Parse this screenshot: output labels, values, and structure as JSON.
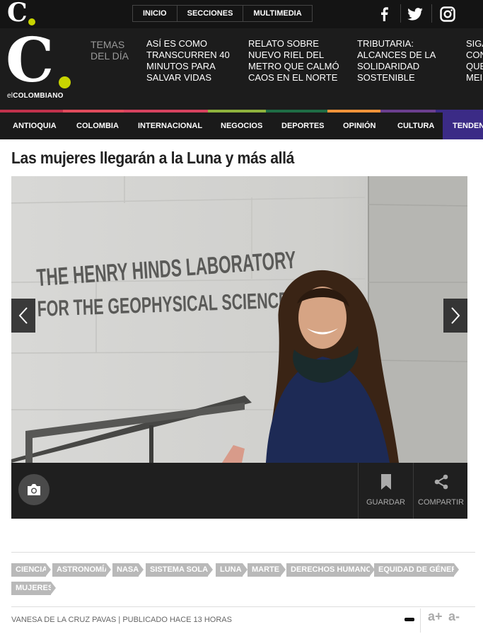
{
  "header": {
    "logo_letter": "C",
    "top_nav": [
      "INICIO",
      "SECCIONES",
      "MULTIMEDIA"
    ],
    "social": [
      "facebook-icon",
      "twitter-icon",
      "instagram-icon"
    ],
    "brand_prefix": "el",
    "brand_name": "COLOMBIANO",
    "temas_label": "TEMAS DEL DÍA",
    "topics": [
      "ASÍ ES COMO TRANSCURREN 40 MINUTOS PARA SALVAR VIDAS",
      "RELATO SOBRE NUEVO RIEL DEL METRO QUE CALMÓ CAOS EN EL NORTE",
      "TRIBUTARIA: ALCANCES DE LA SOLIDARIDAD SOSTENIBLE",
      "SIGA CON QUE MEI"
    ],
    "accent_color": "#c8d400"
  },
  "sections": {
    "items": [
      "ANTIOQUIA",
      "COLOMBIA",
      "INTERNACIONAL",
      "NEGOCIOS",
      "DEPORTES",
      "OPINIÓN",
      "CULTURA",
      "TENDEN"
    ],
    "bar_colors": [
      "#c0314b",
      "#e04b5c",
      "#d5435f",
      "#8fb23d",
      "#1f6d45",
      "#f0933a",
      "#6b3f8f",
      "#3b2b86"
    ]
  },
  "article": {
    "title": "Las mujeres llegarán a la Luna y más allá",
    "photo_sign_line1": "THE HENRY HINDS LABORATORY",
    "photo_sign_line2": "FOR THE GEOPHYSICAL SCIENCES",
    "save_label": "GUARDAR",
    "share_label": "COMPARTIR",
    "tags": [
      "CIENCIA",
      "ASTRONOMÍA",
      "NASA",
      "SISTEMA SOLAR",
      "LUNA",
      "MARTE",
      "DERECHOS HUMANOS",
      "EQUIDAD DE GÉNERO",
      "MUJERES"
    ],
    "byline": "VANESA DE LA CRUZ PAVAS | PUBLICADO HACE 13 HORAS",
    "font_increase": "a+",
    "font_decrease": "a-"
  }
}
